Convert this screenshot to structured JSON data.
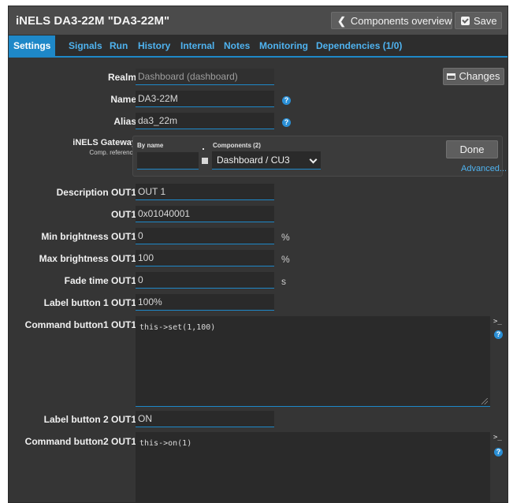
{
  "window": {
    "title": "iNELS DA3-22M \"DA3-22M\"",
    "components_overview_label": "Components overview",
    "save_label": "Save"
  },
  "tabs": [
    {
      "label": "Settings",
      "active": true
    },
    {
      "label": "Signals"
    },
    {
      "label": "Run"
    },
    {
      "label": "History"
    },
    {
      "label": "Internal"
    },
    {
      "label": "Notes"
    },
    {
      "label": "Monitoring"
    },
    {
      "label": "Dependencies (1/0)"
    }
  ],
  "changes_label": "Changes",
  "fields": {
    "realm": {
      "label": "Realm",
      "value": "Dashboard (dashboard)"
    },
    "name": {
      "label": "Name",
      "value": "DA3-22M"
    },
    "alias": {
      "label": "Alias",
      "value": "da3_22m"
    },
    "description_out1": {
      "label": "Description OUT1",
      "value": "OUT 1"
    },
    "out1": {
      "label": "OUT1",
      "value": "0x01040001"
    },
    "min_brightness": {
      "label": "Min brightness OUT1",
      "value": "0",
      "unit": "%"
    },
    "max_brightness": {
      "label": "Max brightness OUT1",
      "value": "100",
      "unit": "%"
    },
    "fade_time": {
      "label": "Fade time OUT1",
      "value": "0",
      "unit": "s"
    },
    "label_button1": {
      "label": "Label button 1 OUT1",
      "value": "100%"
    },
    "command_button1": {
      "label": "Command button1 OUT1",
      "value": "this->set(1,100)"
    },
    "label_button2": {
      "label": "Label button 2 OUT1",
      "value": "ON"
    },
    "command_button2": {
      "label": "Command button2 OUT1",
      "value": "this->on(1)"
    }
  },
  "gateway": {
    "label": "iNELS Gateway",
    "sublabel": "Comp. reference",
    "by_name_label": "By name",
    "by_name_value": "",
    "components_label": "Components (2)",
    "selected_component": "Dashboard / CU3",
    "done_label": "Done",
    "advanced_label": "Advanced..."
  },
  "help_glyph": "?",
  "terminal_glyph": ">_",
  "colors": {
    "accent": "#1e88c8",
    "link": "#4fb3f0",
    "background": "#353535",
    "titlebar": "#4b4b4b"
  }
}
